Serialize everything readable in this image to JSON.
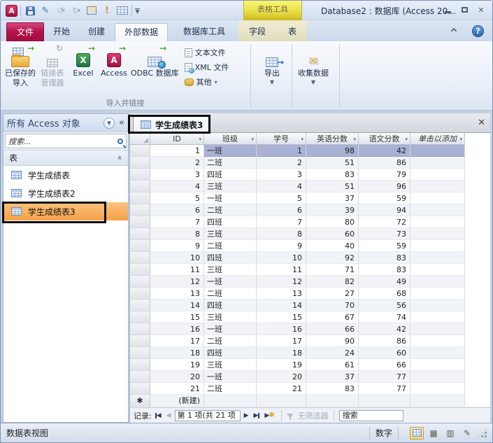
{
  "window": {
    "title": "Database2 : 数据库 (Access 20..."
  },
  "contextual": {
    "label": "表格工具",
    "tabs": [
      "字段",
      "表"
    ]
  },
  "tabs": {
    "file": "文件",
    "items": [
      "开始",
      "创建",
      "外部数据",
      "数据库工具"
    ],
    "active": "外部数据"
  },
  "ribbon": {
    "import": {
      "saved1": "已保存的",
      "saved2": "导入",
      "linked1": "链接表",
      "linked2": "管理器",
      "excel": "Excel",
      "access": "Access",
      "odbc": "ODBC 数据库",
      "text_file": "文本文件",
      "xml_file": "XML 文件",
      "other": "其他",
      "group_label": "导入并链接"
    },
    "export": {
      "label": "导出"
    },
    "collect": {
      "label": "收集数据"
    }
  },
  "nav_pane": {
    "header": "所有 Access 对象",
    "search_placeholder": "搜索...",
    "section": "表",
    "items": [
      {
        "label": "学生成绩表",
        "selected": false
      },
      {
        "label": "学生成绩表2",
        "selected": false
      },
      {
        "label": "学生成绩表3",
        "selected": true
      }
    ]
  },
  "document": {
    "tab": "学生成绩表3",
    "table": {
      "columns": [
        "ID",
        "班级",
        "学号",
        "英语分数",
        "语文分数",
        "单击以添加"
      ],
      "rows": [
        [
          1,
          "一班",
          1,
          98,
          42
        ],
        [
          2,
          "二班",
          2,
          51,
          86
        ],
        [
          3,
          "四班",
          3,
          83,
          79
        ],
        [
          4,
          "三班",
          4,
          51,
          96
        ],
        [
          5,
          "一班",
          5,
          37,
          59
        ],
        [
          6,
          "二班",
          6,
          39,
          94
        ],
        [
          7,
          "四班",
          7,
          80,
          72
        ],
        [
          8,
          "三班",
          8,
          60,
          73
        ],
        [
          9,
          "二班",
          9,
          40,
          59
        ],
        [
          10,
          "四班",
          10,
          92,
          83
        ],
        [
          11,
          "三班",
          11,
          71,
          83
        ],
        [
          12,
          "一班",
          12,
          82,
          49
        ],
        [
          13,
          "二班",
          13,
          27,
          68
        ],
        [
          14,
          "四班",
          14,
          70,
          56
        ],
        [
          15,
          "三班",
          15,
          67,
          74
        ],
        [
          16,
          "一班",
          16,
          66,
          42
        ],
        [
          17,
          "二班",
          17,
          90,
          86
        ],
        [
          18,
          "四班",
          18,
          24,
          60
        ],
        [
          19,
          "三班",
          19,
          61,
          66
        ],
        [
          20,
          "一班",
          20,
          37,
          77
        ],
        [
          21,
          "二班",
          21,
          83,
          77
        ]
      ],
      "new_row_label": "(新建)",
      "selected_row": 1
    },
    "record_nav": {
      "prefix": "记录:",
      "position": "第 1 项(共 21 项",
      "filter": "无筛选器",
      "search": "搜索"
    }
  },
  "status_bar": {
    "left": "数据表视图",
    "num_lock": "数字"
  }
}
